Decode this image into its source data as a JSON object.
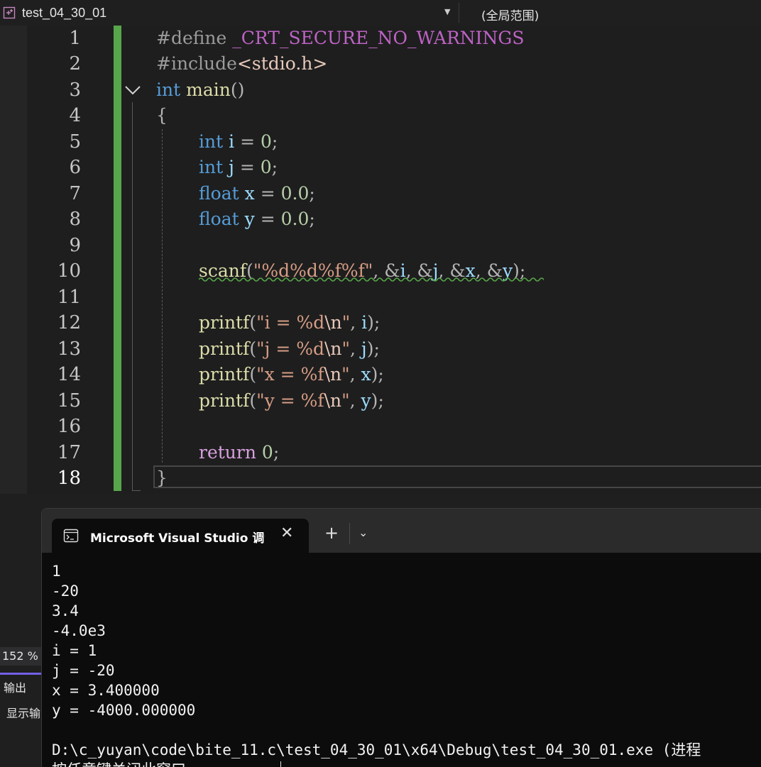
{
  "toolbar": {
    "project_name": "test_04_30_01",
    "scope": "(全局范围)"
  },
  "editor": {
    "line_numbers": [
      "1",
      "2",
      "3",
      "4",
      "5",
      "6",
      "7",
      "8",
      "9",
      "10",
      "11",
      "12",
      "13",
      "14",
      "15",
      "16",
      "17",
      "18"
    ],
    "lines": [
      "#define _CRT_SECURE_NO_WARNINGS",
      "#include<stdio.h>",
      "int main()",
      "{",
      "int i = 0;",
      "int j = 0;",
      "float x = 0.0;",
      "float y = 0.0;",
      "",
      "scanf(\"%d%d%f%f\", &i, &j, &x, &y);",
      "",
      "printf(\"i = %d\\n\", i);",
      "printf(\"j = %d\\n\", j);",
      "printf(\"x = %f\\n\", x);",
      "printf(\"y = %f\\n\", y);",
      "",
      "return 0;",
      "}"
    ]
  },
  "status": {
    "zoom": "152 %",
    "output_tab": "输出",
    "show_output": "显示输"
  },
  "terminal": {
    "tab_title": "Microsoft Visual Studio 调试控制台",
    "close_glyph": "✕",
    "new_tab_glyph": "+",
    "dropdown_glyph": "⌄",
    "output": "1\n-20\n3.4\n-4.0e3\ni = 1\nj = -20\nx = 3.400000\ny = -4000.000000\n\nD:\\c_yuyan\\code\\bite_11.c\\test_04_30_01\\x64\\Debug\\test_04_30_01.exe (进程\n按任意键关闭此窗口. . ."
  }
}
